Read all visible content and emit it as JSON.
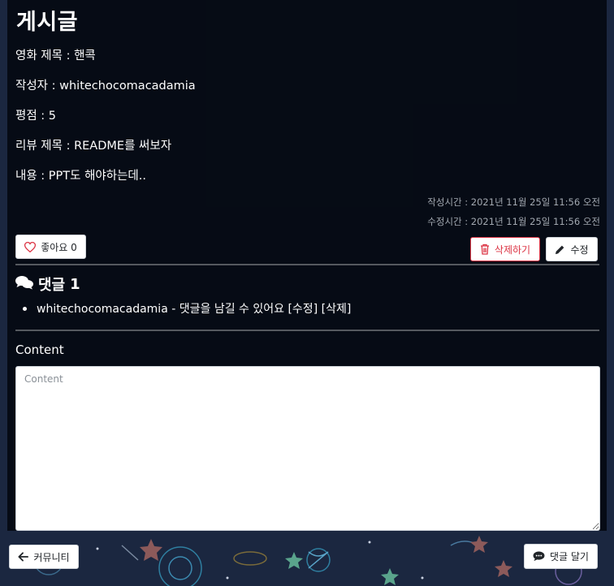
{
  "post": {
    "heading": "게시글",
    "movie_title": "영화 제목 : 핸콕",
    "author": "작성자 : whitechocomacadamia",
    "rating": "평점 : 5",
    "review_title": "리뷰 제목 : README를 써보자",
    "body": "내용 : PPT도 해야하는데..",
    "created_at": "작성시간 : 2021년 11월 25일 11:56 오전",
    "updated_at": "수정시간 : 2021년 11월 25일 11:56 오전"
  },
  "actions": {
    "like_label": "좋아요",
    "like_count": "0",
    "delete_label": "삭제하기",
    "edit_label": "수정"
  },
  "comments": {
    "heading": "댓글",
    "count": "1",
    "items": [
      {
        "author": "whitechocomacadamia",
        "separator": " - ",
        "text": "댓글을 남길 수 있어요",
        "edit_label": "[수정]",
        "delete_label": "[삭제]"
      }
    ]
  },
  "form": {
    "label": "Content",
    "placeholder": "Content",
    "value": ""
  },
  "footer": {
    "back_label": "커뮤니티",
    "submit_label": "댓글 달기"
  },
  "icons": {
    "like": "heart-outline-icon",
    "delete": "trash-icon",
    "edit": "pencil-icon",
    "comments": "comments-icon",
    "back": "arrow-left-icon",
    "submit": "comment-dots-icon"
  },
  "colors": {
    "background": "#1b2740",
    "panel": "#03070e",
    "danger": "#dc3545",
    "timestamp": "#a2a8b0"
  }
}
